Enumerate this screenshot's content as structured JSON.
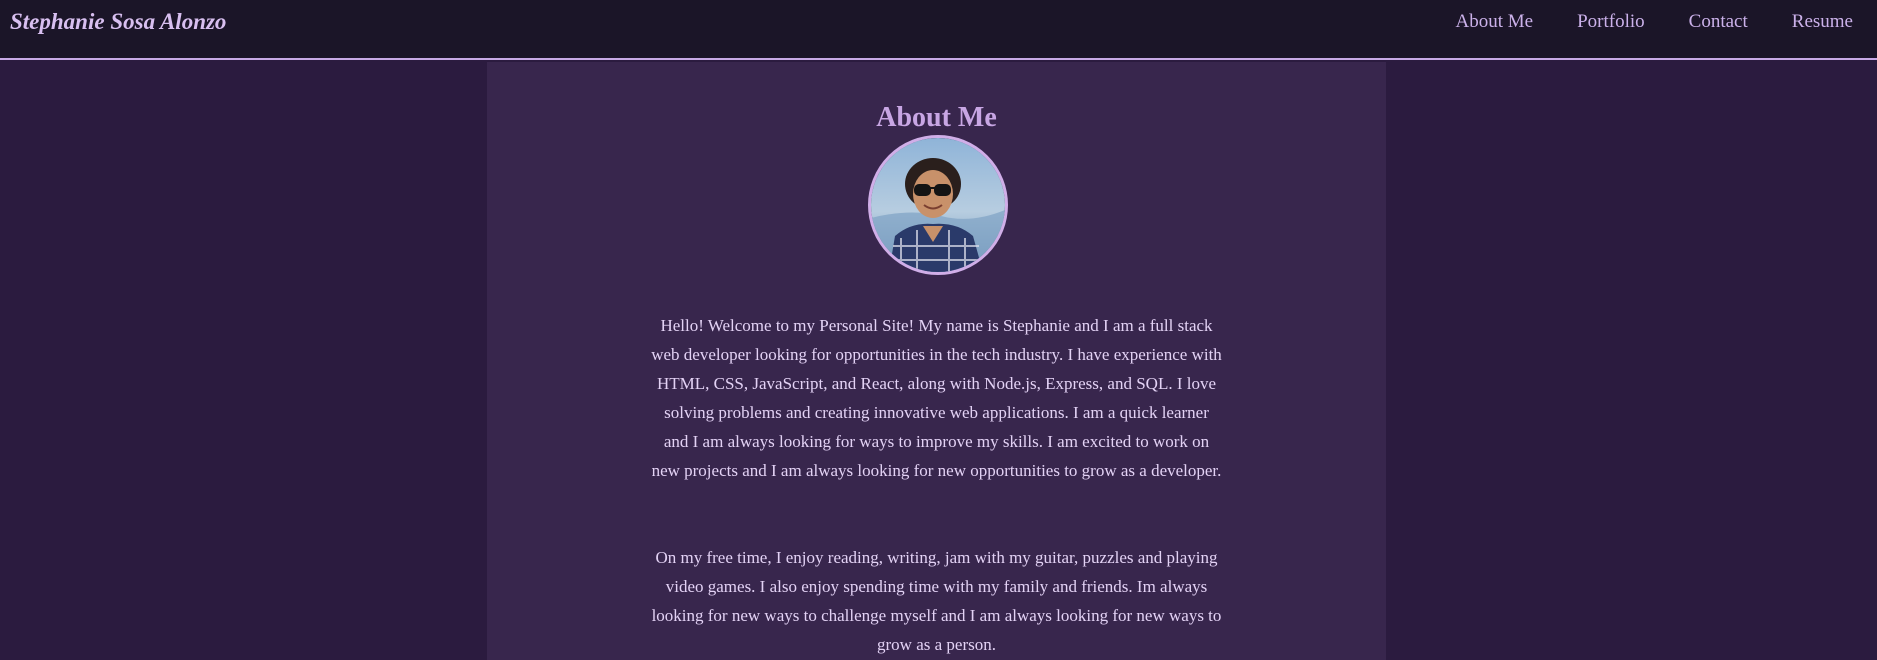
{
  "header": {
    "brand": "Stephanie Sosa Alonzo",
    "nav": [
      {
        "label": "About Me"
      },
      {
        "label": "Portfolio"
      },
      {
        "label": "Contact"
      },
      {
        "label": "Resume"
      }
    ]
  },
  "about": {
    "title": "About Me",
    "paragraphs": [
      "Hello! Welcome to my Personal Site! My name is Stephanie and I am a full stack web developer looking for opportunities in the tech industry. I have experience with HTML, CSS, JavaScript, and React, along with Node.js, Express, and SQL. I love solving problems and creating innovative web applications. I am a quick learner and I am always looking for ways to improve my skills. I am excited to work on new projects and I am always looking for new opportunities to grow as a developer.",
      "On my free time, I enjoy reading, writing, jam with my guitar, puzzles and playing video games. I also enjoy spending time with my family and friends. Im always looking for new ways to challenge myself and I am always looking for new ways to grow as a person."
    ]
  },
  "colors": {
    "header_bg": "#1b1528",
    "page_bg": "#2b1b3f",
    "content_bg": "#38264d",
    "accent": "#c8a6e4",
    "text": "#e3d2f5"
  }
}
